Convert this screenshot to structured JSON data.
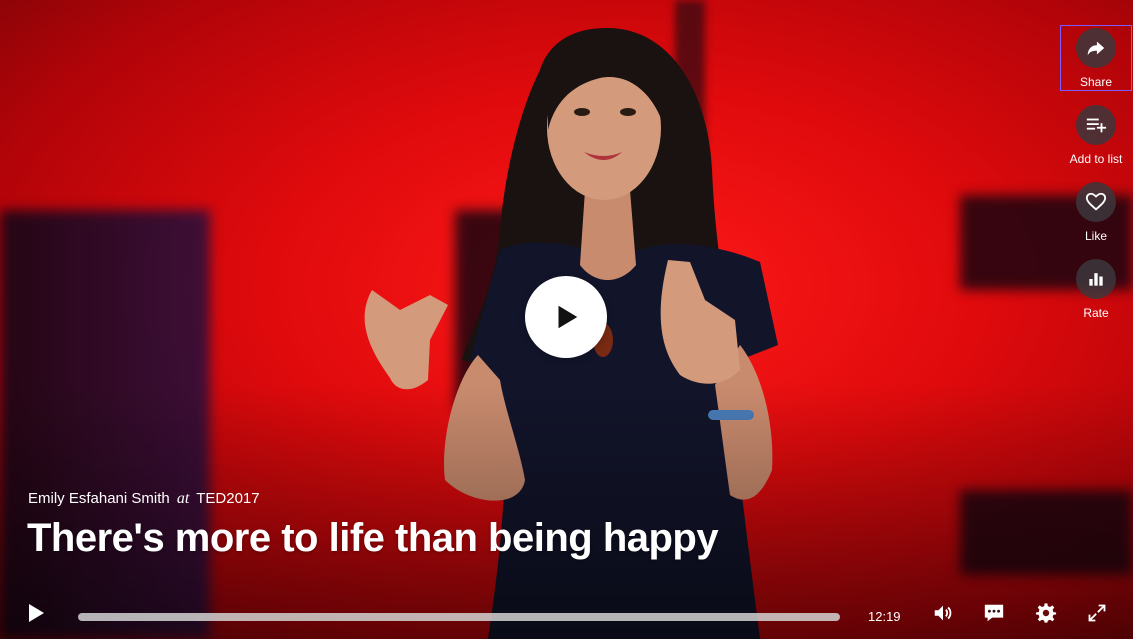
{
  "video": {
    "speaker": "Emily Esfahani Smith",
    "at_word": "at",
    "event": "TED2017",
    "title": "There's more to life than being happy",
    "duration": "12:19",
    "progress_fraction": 0
  },
  "rail": {
    "share_label": "Share",
    "add_to_list_label": "Add to list",
    "like_label": "Like",
    "rate_label": "Rate"
  },
  "icons": {
    "share": "share-arrow-icon",
    "add_list": "playlist-add-icon",
    "like": "heart-icon",
    "rate": "bar-chart-icon",
    "play": "play-icon",
    "volume": "volume-icon",
    "captions": "captions-icon",
    "settings": "gear-icon",
    "fullscreen": "fullscreen-icon"
  },
  "colors": {
    "stage_red": "#e5070f",
    "focus_outline": "#7a5cff"
  }
}
